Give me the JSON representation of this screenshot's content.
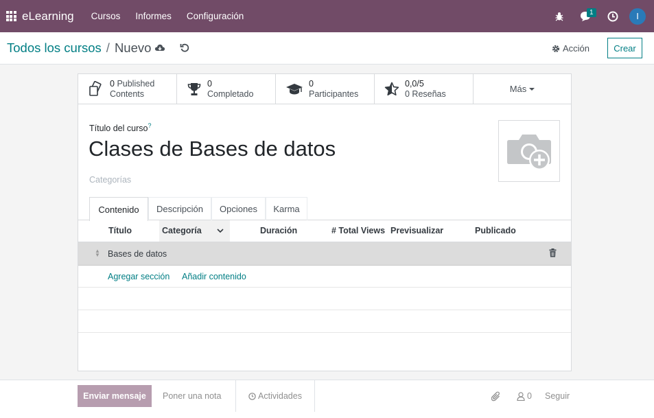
{
  "navbar": {
    "brand": "eLearning",
    "menu": [
      "Cursos",
      "Informes",
      "Configuración"
    ],
    "message_count": "1",
    "user_initial": "I",
    "color": "#714b67"
  },
  "control": {
    "breadcrumb_parent": "Todos los cursos",
    "breadcrumb_separator": "/",
    "breadcrumb_current": "Nuevo",
    "action_label": "Acción",
    "create_label": "Crear"
  },
  "stats": [
    {
      "value": "0",
      "label_1": "Published",
      "label_2": "Contents",
      "icon": "contents-icon"
    },
    {
      "value": "0",
      "label_2": "Completado",
      "icon": "trophy-icon"
    },
    {
      "value": "0",
      "label_2": "Participantes",
      "icon": "graduation-cap-icon"
    },
    {
      "value": "0,0/5",
      "label_2": "0 Reseñas",
      "icon": "star-icon"
    }
  ],
  "more_label": "Más",
  "form": {
    "title_label": "Título del curso",
    "help_mark": "?",
    "course_name": "Clases de Bases de datos",
    "categories_placeholder": "Categorías"
  },
  "tabs": [
    "Contenido",
    "Descripción",
    "Opciones",
    "Karma"
  ],
  "columns": {
    "title": "Título",
    "category": "Categoría",
    "duration": "Duración",
    "views": "# Total Views",
    "preview": "Previsualizar",
    "published": "Publicado"
  },
  "section": {
    "name": "Bases de datos"
  },
  "add_links": {
    "section": "Agregar sección",
    "content": "Añadir contenido"
  },
  "chatter": {
    "send_label": "Enviar mensaje",
    "note_label": "Poner una nota",
    "activities_label": "Actividades",
    "followers_count": "0",
    "follow_label": "Seguir"
  },
  "accent_color": "#017e84"
}
